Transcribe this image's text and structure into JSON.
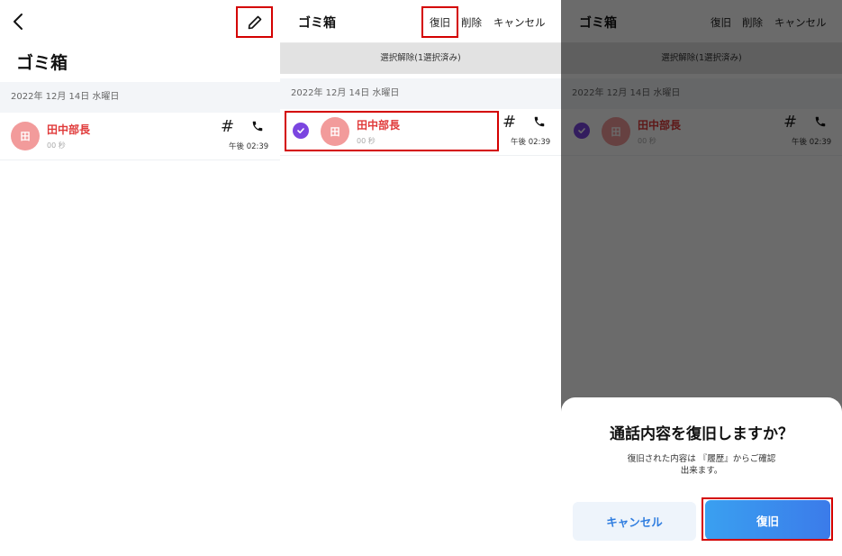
{
  "trash_title": "ゴミ箱",
  "date_label": "2022年 12月 14日 水曜日",
  "entry": {
    "avatar": "田",
    "name": "田中部長",
    "duration": "00 秒",
    "time": "午後 02:39",
    "hash": "#"
  },
  "header": {
    "title": "ゴミ箱",
    "restore_label": "復旧",
    "delete_label": "削除",
    "cancel_label": "キャンセル"
  },
  "deselect_label": "選択解除(1選択済み)",
  "dialog": {
    "title": "通話内容を復旧しますか？",
    "message_line1": "復旧された内容は 『履歴』からご確認",
    "message_line2": "出来ます。",
    "cancel_label": "キャンセル",
    "confirm_label": "復旧"
  },
  "colors": {
    "accent_red": "#e03a3a",
    "avatar_pink": "#f29b9b",
    "check_purple": "#7b45e0",
    "button_blue": "#3b7bea",
    "highlight_red": "#d40000"
  },
  "icons": [
    "back-icon",
    "pencil-icon",
    "phone-icon",
    "check-icon"
  ]
}
